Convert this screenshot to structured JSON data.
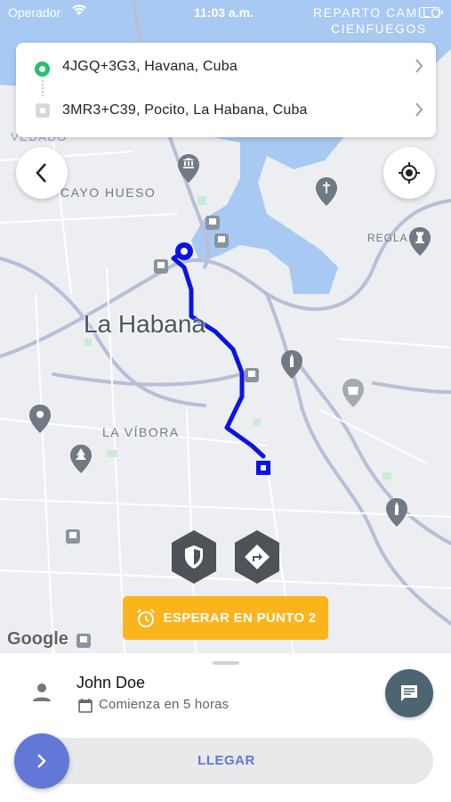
{
  "status_bar": {
    "carrier": "Operador",
    "time": "11:03 a.m."
  },
  "route": {
    "origin": "4JGQ+3G3, Havana, Cuba",
    "destination": "3MR3+C39, Pocito, La Habana, Cuba"
  },
  "map": {
    "city_label": "La Habana",
    "labels": {
      "reparto": "REPARTO CAMILO",
      "cienfuegos": "CIENFUEGOS",
      "vedado": "VEDADO",
      "cayo_hueso": "CAYO HUESO",
      "regla": "REGLA",
      "la_vibora": "LA VÍBORA"
    },
    "route_color": "#0a14e6",
    "water_color": "#a8c9f2"
  },
  "wait_button": {
    "label": "ESPERAR EN PUNTO 2"
  },
  "attribution": "Google",
  "driver": {
    "name": "John Doe",
    "start_time": "Comienza en 5 horas"
  },
  "slider": {
    "label": "LLEGAR"
  },
  "colors": {
    "accent": "#6278d6",
    "wait": "#fbb41c",
    "chat": "#4d6471"
  }
}
